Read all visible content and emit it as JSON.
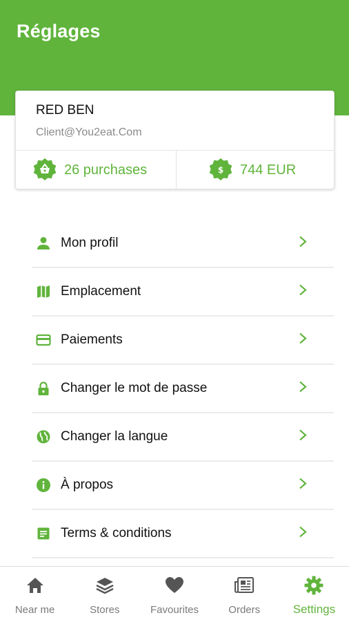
{
  "header": {
    "title": "Réglages",
    "color": "#60b43c"
  },
  "profile": {
    "name": "RED BEN",
    "email": "Client@You2eat.Com",
    "purchases_label": "26 purchases",
    "total_label": "744 EUR"
  },
  "menu": {
    "items": [
      {
        "label": "Mon profil",
        "icon": "person-icon"
      },
      {
        "label": "Emplacement",
        "icon": "map-icon"
      },
      {
        "label": "Paiements",
        "icon": "credit-card-icon"
      },
      {
        "label": "Changer le mot de passe",
        "icon": "lock-icon"
      },
      {
        "label": "Changer la langue",
        "icon": "globe-icon"
      },
      {
        "label": "À propos",
        "icon": "info-icon"
      },
      {
        "label": "Terms & conditions",
        "icon": "document-icon"
      }
    ]
  },
  "tabbar": {
    "tabs": [
      {
        "label": "Near me",
        "icon": "home-icon"
      },
      {
        "label": "Stores",
        "icon": "layers-icon"
      },
      {
        "label": "Favourites",
        "icon": "heart-icon"
      },
      {
        "label": "Orders",
        "icon": "newspaper-icon"
      },
      {
        "label": "Settings",
        "icon": "gear-icon",
        "active": true
      }
    ]
  }
}
